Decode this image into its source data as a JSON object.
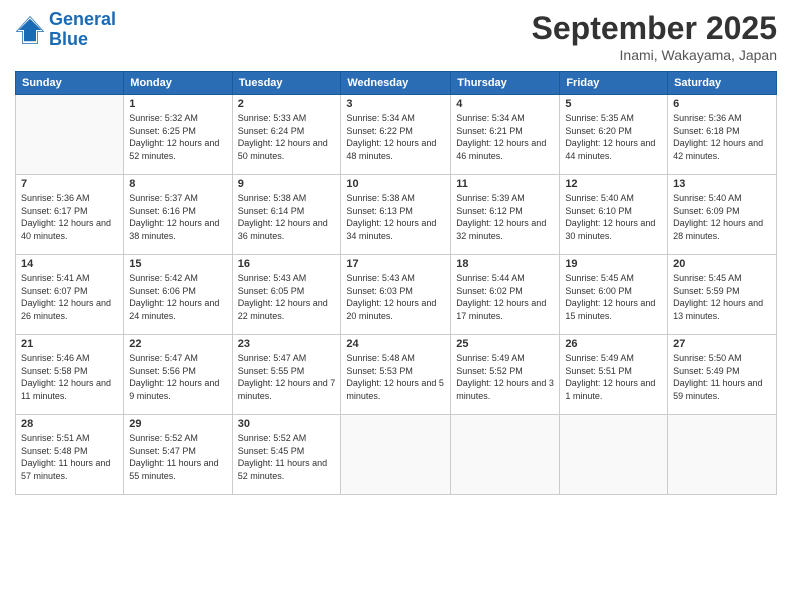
{
  "logo": {
    "line1": "General",
    "line2": "Blue"
  },
  "title": "September 2025",
  "location": "Inami, Wakayama, Japan",
  "weekdays": [
    "Sunday",
    "Monday",
    "Tuesday",
    "Wednesday",
    "Thursday",
    "Friday",
    "Saturday"
  ],
  "weeks": [
    [
      {
        "day": "",
        "sunrise": "",
        "sunset": "",
        "daylight": ""
      },
      {
        "day": "1",
        "sunrise": "Sunrise: 5:32 AM",
        "sunset": "Sunset: 6:25 PM",
        "daylight": "Daylight: 12 hours and 52 minutes."
      },
      {
        "day": "2",
        "sunrise": "Sunrise: 5:33 AM",
        "sunset": "Sunset: 6:24 PM",
        "daylight": "Daylight: 12 hours and 50 minutes."
      },
      {
        "day": "3",
        "sunrise": "Sunrise: 5:34 AM",
        "sunset": "Sunset: 6:22 PM",
        "daylight": "Daylight: 12 hours and 48 minutes."
      },
      {
        "day": "4",
        "sunrise": "Sunrise: 5:34 AM",
        "sunset": "Sunset: 6:21 PM",
        "daylight": "Daylight: 12 hours and 46 minutes."
      },
      {
        "day": "5",
        "sunrise": "Sunrise: 5:35 AM",
        "sunset": "Sunset: 6:20 PM",
        "daylight": "Daylight: 12 hours and 44 minutes."
      },
      {
        "day": "6",
        "sunrise": "Sunrise: 5:36 AM",
        "sunset": "Sunset: 6:18 PM",
        "daylight": "Daylight: 12 hours and 42 minutes."
      }
    ],
    [
      {
        "day": "7",
        "sunrise": "Sunrise: 5:36 AM",
        "sunset": "Sunset: 6:17 PM",
        "daylight": "Daylight: 12 hours and 40 minutes."
      },
      {
        "day": "8",
        "sunrise": "Sunrise: 5:37 AM",
        "sunset": "Sunset: 6:16 PM",
        "daylight": "Daylight: 12 hours and 38 minutes."
      },
      {
        "day": "9",
        "sunrise": "Sunrise: 5:38 AM",
        "sunset": "Sunset: 6:14 PM",
        "daylight": "Daylight: 12 hours and 36 minutes."
      },
      {
        "day": "10",
        "sunrise": "Sunrise: 5:38 AM",
        "sunset": "Sunset: 6:13 PM",
        "daylight": "Daylight: 12 hours and 34 minutes."
      },
      {
        "day": "11",
        "sunrise": "Sunrise: 5:39 AM",
        "sunset": "Sunset: 6:12 PM",
        "daylight": "Daylight: 12 hours and 32 minutes."
      },
      {
        "day": "12",
        "sunrise": "Sunrise: 5:40 AM",
        "sunset": "Sunset: 6:10 PM",
        "daylight": "Daylight: 12 hours and 30 minutes."
      },
      {
        "day": "13",
        "sunrise": "Sunrise: 5:40 AM",
        "sunset": "Sunset: 6:09 PM",
        "daylight": "Daylight: 12 hours and 28 minutes."
      }
    ],
    [
      {
        "day": "14",
        "sunrise": "Sunrise: 5:41 AM",
        "sunset": "Sunset: 6:07 PM",
        "daylight": "Daylight: 12 hours and 26 minutes."
      },
      {
        "day": "15",
        "sunrise": "Sunrise: 5:42 AM",
        "sunset": "Sunset: 6:06 PM",
        "daylight": "Daylight: 12 hours and 24 minutes."
      },
      {
        "day": "16",
        "sunrise": "Sunrise: 5:43 AM",
        "sunset": "Sunset: 6:05 PM",
        "daylight": "Daylight: 12 hours and 22 minutes."
      },
      {
        "day": "17",
        "sunrise": "Sunrise: 5:43 AM",
        "sunset": "Sunset: 6:03 PM",
        "daylight": "Daylight: 12 hours and 20 minutes."
      },
      {
        "day": "18",
        "sunrise": "Sunrise: 5:44 AM",
        "sunset": "Sunset: 6:02 PM",
        "daylight": "Daylight: 12 hours and 17 minutes."
      },
      {
        "day": "19",
        "sunrise": "Sunrise: 5:45 AM",
        "sunset": "Sunset: 6:00 PM",
        "daylight": "Daylight: 12 hours and 15 minutes."
      },
      {
        "day": "20",
        "sunrise": "Sunrise: 5:45 AM",
        "sunset": "Sunset: 5:59 PM",
        "daylight": "Daylight: 12 hours and 13 minutes."
      }
    ],
    [
      {
        "day": "21",
        "sunrise": "Sunrise: 5:46 AM",
        "sunset": "Sunset: 5:58 PM",
        "daylight": "Daylight: 12 hours and 11 minutes."
      },
      {
        "day": "22",
        "sunrise": "Sunrise: 5:47 AM",
        "sunset": "Sunset: 5:56 PM",
        "daylight": "Daylight: 12 hours and 9 minutes."
      },
      {
        "day": "23",
        "sunrise": "Sunrise: 5:47 AM",
        "sunset": "Sunset: 5:55 PM",
        "daylight": "Daylight: 12 hours and 7 minutes."
      },
      {
        "day": "24",
        "sunrise": "Sunrise: 5:48 AM",
        "sunset": "Sunset: 5:53 PM",
        "daylight": "Daylight: 12 hours and 5 minutes."
      },
      {
        "day": "25",
        "sunrise": "Sunrise: 5:49 AM",
        "sunset": "Sunset: 5:52 PM",
        "daylight": "Daylight: 12 hours and 3 minutes."
      },
      {
        "day": "26",
        "sunrise": "Sunrise: 5:49 AM",
        "sunset": "Sunset: 5:51 PM",
        "daylight": "Daylight: 12 hours and 1 minute."
      },
      {
        "day": "27",
        "sunrise": "Sunrise: 5:50 AM",
        "sunset": "Sunset: 5:49 PM",
        "daylight": "Daylight: 11 hours and 59 minutes."
      }
    ],
    [
      {
        "day": "28",
        "sunrise": "Sunrise: 5:51 AM",
        "sunset": "Sunset: 5:48 PM",
        "daylight": "Daylight: 11 hours and 57 minutes."
      },
      {
        "day": "29",
        "sunrise": "Sunrise: 5:52 AM",
        "sunset": "Sunset: 5:47 PM",
        "daylight": "Daylight: 11 hours and 55 minutes."
      },
      {
        "day": "30",
        "sunrise": "Sunrise: 5:52 AM",
        "sunset": "Sunset: 5:45 PM",
        "daylight": "Daylight: 11 hours and 52 minutes."
      },
      {
        "day": "",
        "sunrise": "",
        "sunset": "",
        "daylight": ""
      },
      {
        "day": "",
        "sunrise": "",
        "sunset": "",
        "daylight": ""
      },
      {
        "day": "",
        "sunrise": "",
        "sunset": "",
        "daylight": ""
      },
      {
        "day": "",
        "sunrise": "",
        "sunset": "",
        "daylight": ""
      }
    ]
  ]
}
